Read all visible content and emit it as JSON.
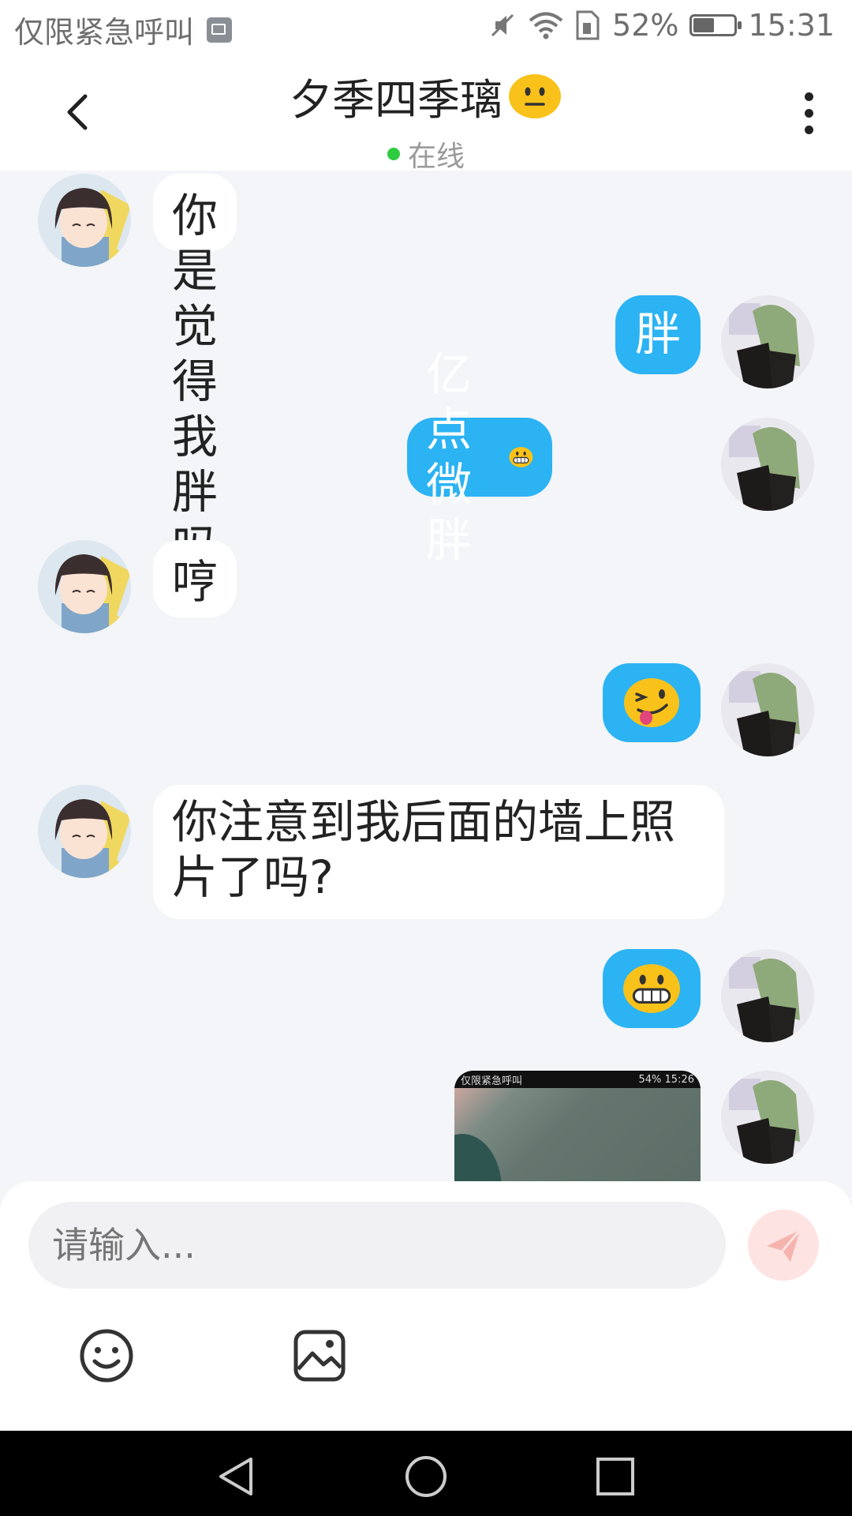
{
  "status_bar": {
    "carrier_text": "仅限紧急呼叫",
    "battery_percent": "52%",
    "battery_level": 0.52,
    "time": "15:31",
    "icons": [
      "image-notification-icon",
      "mute-icon",
      "wifi-icon",
      "sim-icon",
      "battery-icon"
    ]
  },
  "header": {
    "title": "夕季四季璃",
    "title_emoji": "neutral-face-emoji",
    "status_text": "在线",
    "status_color": "#2ecc40",
    "back_icon": "chevron-left-icon",
    "more_icon": "more-vertical-icon"
  },
  "messages": [
    {
      "side": "in",
      "text": "你是觉得我胖吗"
    },
    {
      "side": "out",
      "text": "胖"
    },
    {
      "side": "out",
      "text": "亿点微胖",
      "emoji": "grinning-face-emoji"
    },
    {
      "side": "in",
      "text": "哼"
    },
    {
      "side": "out",
      "text": "",
      "emoji": "winking-tongue-emoji"
    },
    {
      "side": "in",
      "text_line1": "你注意到我后面的墙上照",
      "text_line2": "片了吗?"
    },
    {
      "side": "out",
      "text": "",
      "emoji": "grinning-face-emoji"
    },
    {
      "side": "out",
      "type": "image",
      "thumbnail": {
        "status_left": "仅限紧急呼叫",
        "status_battery": "54%",
        "status_time": "15:26"
      }
    }
  ],
  "composer": {
    "placeholder": "请输入...",
    "send_icon": "send-icon",
    "tools": [
      "emoji-icon",
      "image-icon"
    ]
  },
  "colors": {
    "bubble_out": "#2bb3f3",
    "bubble_in": "#ffffff",
    "chat_background": "#f3f5f8"
  },
  "navbar": {
    "buttons": [
      "back-triangle-icon",
      "home-circle-icon",
      "recents-square-icon"
    ]
  }
}
